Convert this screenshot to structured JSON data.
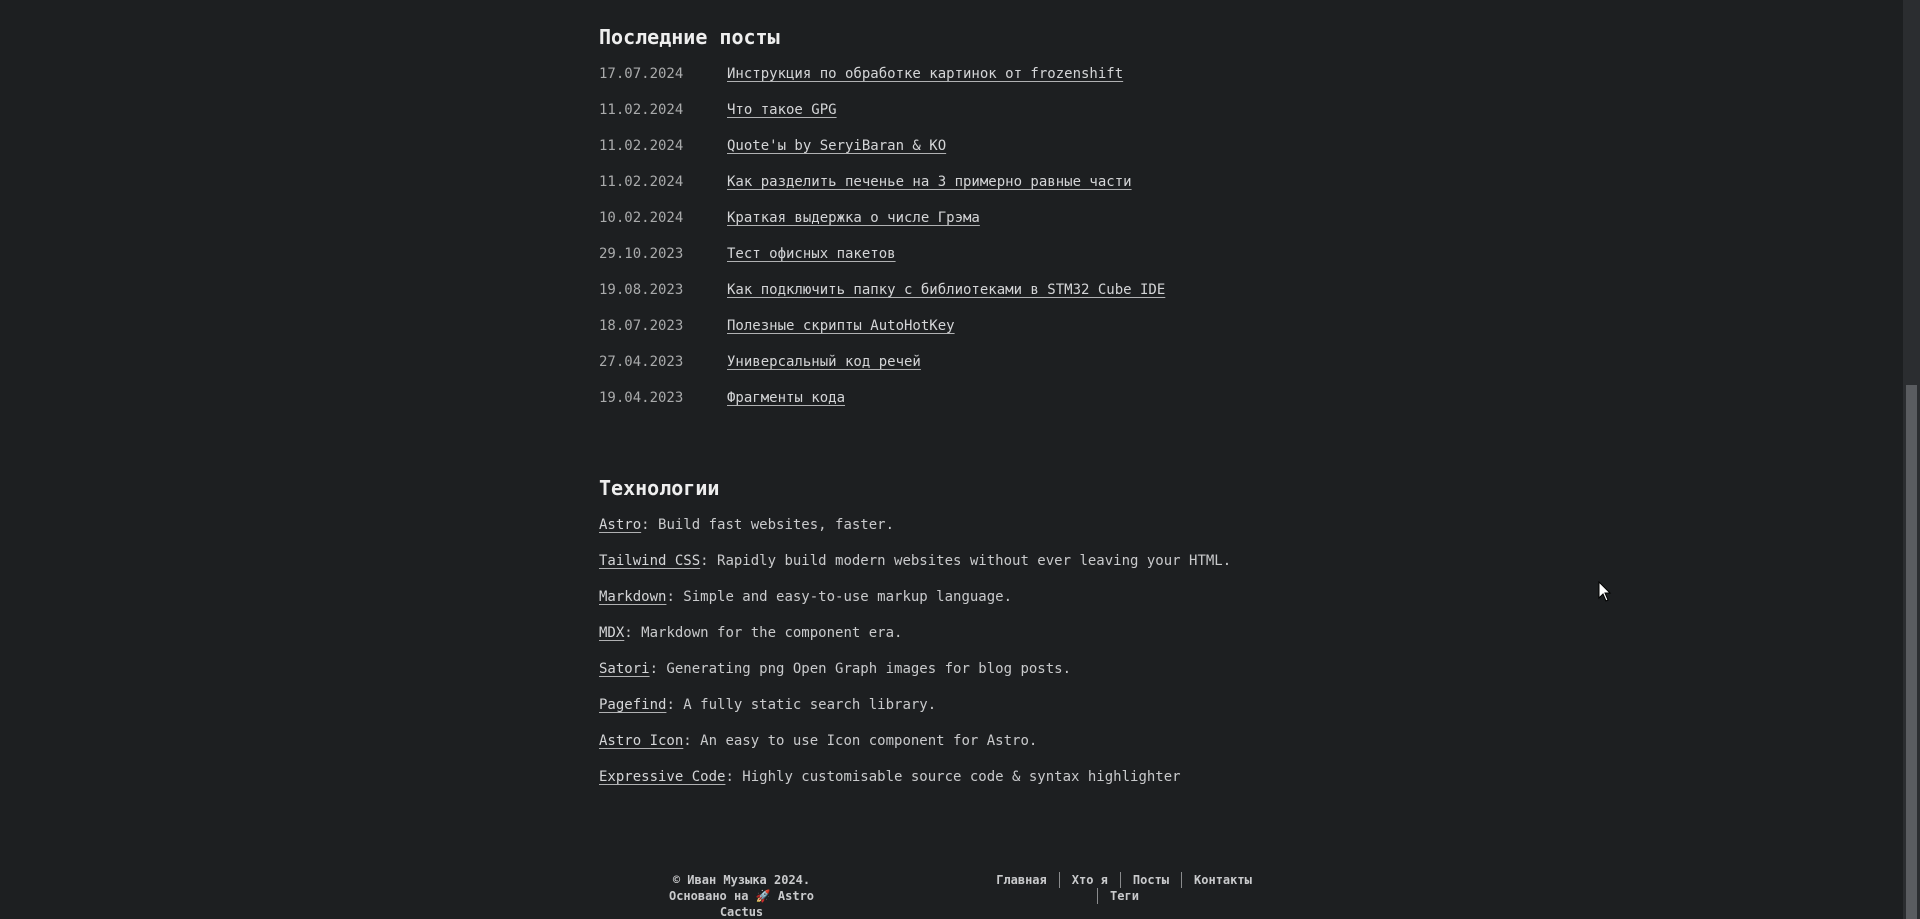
{
  "recent_posts": {
    "title": "Последние посты",
    "items": [
      {
        "date": "17.07.2024",
        "title": "Инструкция по обработке картинок от frozenshift"
      },
      {
        "date": "11.02.2024",
        "title": "Что такое GPG"
      },
      {
        "date": "11.02.2024",
        "title": "Quote'ы by SeryiBaran & KO"
      },
      {
        "date": "11.02.2024",
        "title": "Как разделить печенье на 3 примерно равные части"
      },
      {
        "date": "10.02.2024",
        "title": "Краткая выдержка о числе Грэма"
      },
      {
        "date": "29.10.2023",
        "title": "Тест офисных пакетов"
      },
      {
        "date": "19.08.2023",
        "title": "Как подключить папку с библиотеками в STM32 Cube IDE"
      },
      {
        "date": "18.07.2023",
        "title": "Полезные скрипты AutoHotKey"
      },
      {
        "date": "27.04.2023",
        "title": "Универсальный код речей"
      },
      {
        "date": "19.04.2023",
        "title": "Фрагменты кода"
      }
    ]
  },
  "technologies": {
    "title": "Технологии",
    "items": [
      {
        "name": "Astro",
        "description": ": Build fast websites, faster."
      },
      {
        "name": "Tailwind CSS",
        "description": ": Rapidly build modern websites without ever leaving your HTML."
      },
      {
        "name": "Markdown",
        "description": ": Simple and easy-to-use markup language."
      },
      {
        "name": "MDX",
        "description": ": Markdown for the component era."
      },
      {
        "name": "Satori",
        "description": ": Generating png Open Graph images for blog posts."
      },
      {
        "name": "Pagefind",
        "description": ": A fully static search library."
      },
      {
        "name": "Astro Icon",
        "description": ": An easy to use Icon component for Astro."
      },
      {
        "name": "Expressive Code",
        "description": ": Highly customisable source code & syntax highlighter"
      }
    ]
  },
  "footer": {
    "copyright": "© Иван Музыка 2024.",
    "built_with_prefix": "Основано на",
    "built_with_icon": "🚀",
    "built_with_name": "Astro Cactus",
    "nav": {
      "home": "Главная",
      "about": "Хто я",
      "posts": "Посты",
      "contacts": "Контакты",
      "tags": "Теги"
    }
  },
  "colors": {
    "background": "#1d1f21",
    "text": "#c9cacc",
    "heading": "#eeeeee"
  }
}
